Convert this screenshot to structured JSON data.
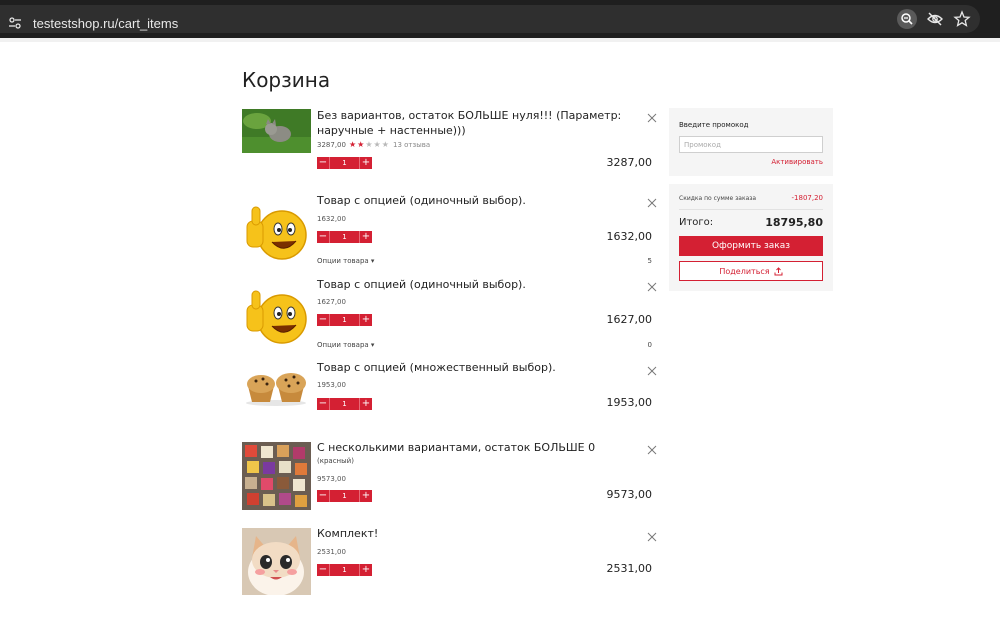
{
  "browser": {
    "url": "testestshop.ru/cart_items",
    "icons": [
      "site-settings-icon",
      "zoom-icon",
      "eye-off-icon",
      "star-icon"
    ]
  },
  "page": {
    "title": "Корзина"
  },
  "cart": {
    "items": [
      {
        "name": "Без вариантов, остаток БОЛЬШЕ нуля!!! (Параметр: наручные + настенные)))",
        "price": "3287,00",
        "rating": 2,
        "reviews": "13 отзыва",
        "quantity": "1",
        "total": "3287,00"
      },
      {
        "name": "Товар с опцией (одиночный выбор).",
        "price": "1632,00",
        "quantity": "1",
        "total": "1632,00",
        "options_label": "Опции товара",
        "options_count": "5"
      },
      {
        "name": "Товар с опцией (одиночный выбор).",
        "price": "1627,00",
        "quantity": "1",
        "total": "1627,00",
        "options_label": "Опции товара",
        "options_count": "0"
      },
      {
        "name": "Товар с опцией (множественный выбор).",
        "price": "1953,00",
        "quantity": "1",
        "total": "1953,00"
      },
      {
        "name": "С несколькими вариантами, остаток БОЛЬШЕ 0",
        "variant": "(красный)",
        "price": "9573,00",
        "quantity": "1",
        "total": "9573,00"
      },
      {
        "name": "Комплект!",
        "price": "2531,00",
        "quantity": "1",
        "total": "2531,00"
      }
    ]
  },
  "promo": {
    "title": "Введите промокод",
    "placeholder": "Промокод",
    "activate": "Активировать"
  },
  "summary": {
    "discount_label": "Скидка по сумме заказа",
    "discount_value": "-1807,20",
    "total_label": "Итого:",
    "total_value": "18795,80",
    "checkout": "Оформить заказ",
    "share": "Поделиться"
  },
  "colors": {
    "accent": "#d42033",
    "panel": "#f5f5f5"
  }
}
